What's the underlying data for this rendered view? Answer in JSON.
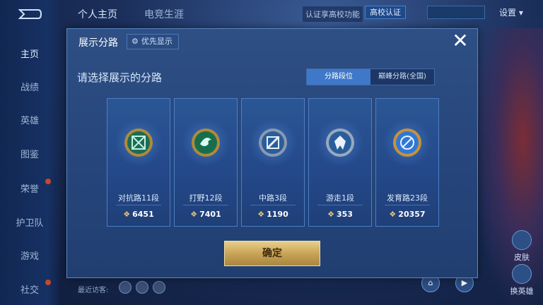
{
  "sidebar": {
    "items": [
      {
        "label": "主页",
        "active": true
      },
      {
        "label": "战绩"
      },
      {
        "label": "英雄"
      },
      {
        "label": "图鉴"
      },
      {
        "label": "荣誉"
      },
      {
        "label": "护卫队"
      },
      {
        "label": "游戏"
      },
      {
        "label": "社交"
      }
    ]
  },
  "topbar": {
    "tabs": [
      "个人主页",
      "电竞生涯"
    ],
    "verify_text": "认证享高校功能",
    "uni_button": "高校认证",
    "settings": "设置"
  },
  "dialog": {
    "title": "展示分路",
    "priority_label": "优先显示",
    "prompt": "请选择展示的分路",
    "segments": [
      "分路段位",
      "巅峰分路(全国)"
    ],
    "selected_segment": 0,
    "cards": [
      {
        "name": "对抗路11段",
        "score": "6451",
        "icon": "top-lane-emblem-icon",
        "color": "#2bb38a"
      },
      {
        "name": "打野12段",
        "score": "7401",
        "icon": "jungle-emblem-icon",
        "color": "#23a06f"
      },
      {
        "name": "中路3段",
        "score": "1190",
        "icon": "mid-lane-emblem-icon",
        "color": "#9fb3cf"
      },
      {
        "name": "游走1段",
        "score": "353",
        "icon": "roam-emblem-icon",
        "color": "#a8b8d0"
      },
      {
        "name": "发育路23段",
        "score": "20357",
        "icon": "farm-lane-emblem-icon",
        "color": "#2f78d6"
      }
    ],
    "confirm_label": "确定"
  },
  "bottom": {
    "visitors_label": "最近访客:"
  },
  "right": {
    "btn1": "皮肤",
    "btn2": "换英雄"
  },
  "colors": {
    "accent_gold": "#c9a458",
    "segment_active": "#3f78c8"
  }
}
